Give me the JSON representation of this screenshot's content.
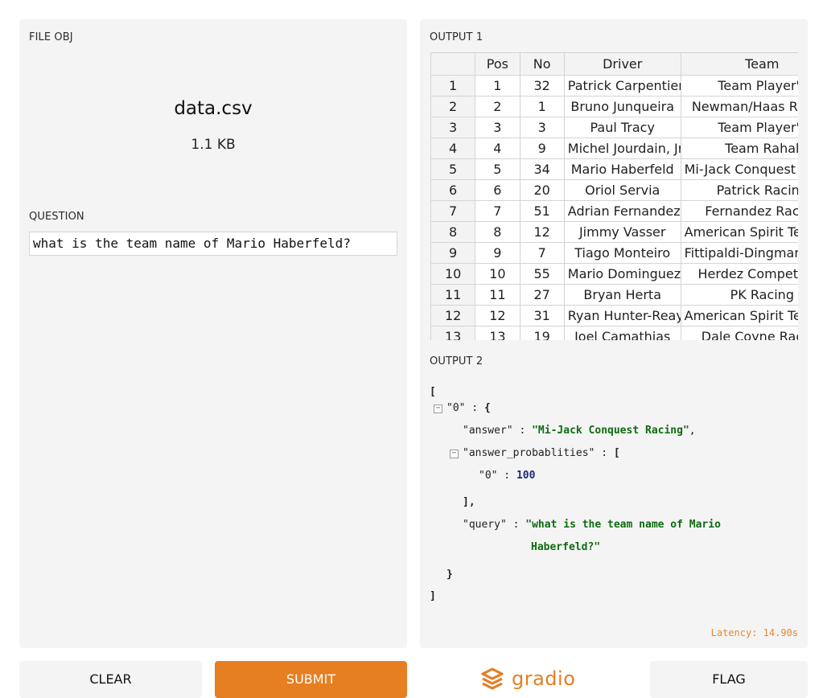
{
  "left": {
    "file_label": "FILE OBJ",
    "file_name": "data.csv",
    "file_size": "1.1 KB",
    "question_label": "QUESTION",
    "question_value": "what is the team name of Mario Haberfeld?"
  },
  "output1": {
    "label": "OUTPUT 1",
    "columns": [
      "",
      "Pos",
      "No",
      "Driver",
      "Team"
    ],
    "rows": [
      [
        "1",
        "1",
        "32",
        "Patrick Carpentier",
        "Team Player's"
      ],
      [
        "2",
        "2",
        "1",
        "Bruno Junqueira",
        "Newman/Haas Racing"
      ],
      [
        "3",
        "3",
        "3",
        "Paul Tracy",
        "Team Player's"
      ],
      [
        "4",
        "4",
        "9",
        "Michel Jourdain, Jr.",
        "Team Rahal"
      ],
      [
        "5",
        "5",
        "34",
        "Mario Haberfeld",
        "Mi-Jack Conquest Racing"
      ],
      [
        "6",
        "6",
        "20",
        "Oriol Servia",
        "Patrick Racing"
      ],
      [
        "7",
        "7",
        "51",
        "Adrian Fernandez",
        "Fernandez Racing"
      ],
      [
        "8",
        "8",
        "12",
        "Jimmy Vasser",
        "American Spirit Team Johansson"
      ],
      [
        "9",
        "9",
        "7",
        "Tiago Monteiro",
        "Fittipaldi-Dingman Racing"
      ],
      [
        "10",
        "10",
        "55",
        "Mario Dominguez",
        "Herdez Competition"
      ],
      [
        "11",
        "11",
        "27",
        "Bryan Herta",
        "PK Racing"
      ],
      [
        "12",
        "12",
        "31",
        "Ryan Hunter-Reay",
        "American Spirit Team Johansson"
      ],
      [
        "13",
        "13",
        "19",
        "Joel Camathias",
        "Dale Coyne Racing"
      ]
    ]
  },
  "output2": {
    "label": "OUTPUT 2",
    "open_bracket": "[",
    "close_bracket": "]",
    "item_key": "\"0\"",
    "answer_key": "\"answer\"",
    "answer_value": "\"Mi-Jack Conquest Racing\"",
    "probs_key": "\"answer_probablities\"",
    "probs_item_key": "\"0\"",
    "probs_item_value": "100",
    "query_key": "\"query\"",
    "query_value_line1": "\"what is the team name of Mario",
    "query_value_line2": "Haberfeld?\"",
    "latency": "Latency: 14.90s"
  },
  "buttons": {
    "clear": "CLEAR",
    "submit": "SUBMIT",
    "flag": "FLAG"
  },
  "brand": {
    "name": "gradio",
    "icon": "gradio-logo-icon",
    "color": "#e67e22"
  }
}
